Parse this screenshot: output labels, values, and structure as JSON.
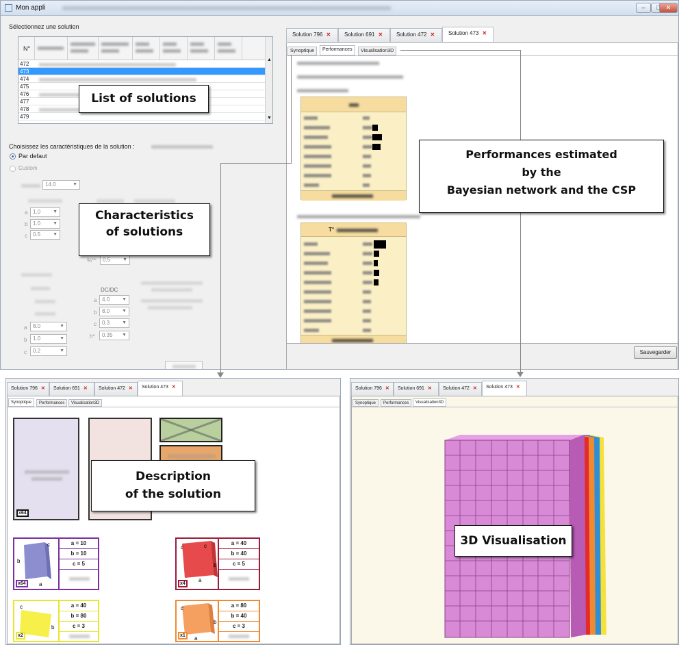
{
  "main_window": {
    "title": "Mon appli",
    "select_label": "Sélectionnez une solution",
    "table_header_first": "N°",
    "rows": [
      "472",
      "473",
      "474",
      "475",
      "476",
      "477",
      "478",
      "479"
    ],
    "characteristics_label": "Choisissez les caractéristiques de la solution :",
    "radio_default": "Par defaut",
    "radio_custom": "Custom",
    "dimension_value": "14.0",
    "combo_a": "1.0",
    "combo_b": "1.0",
    "combo_c": "0.5",
    "combo_pct": "0.5",
    "dcdc_label": "DC/DC",
    "dc_a": "4.0",
    "dc_b": "8.0",
    "dc_c": "0.3",
    "dc_h": "0.35",
    "left_a": "8.0",
    "left_b": "1.0",
    "left_c": "0.2",
    "pct_label": "%**",
    "h_label": "h*",
    "tabs": [
      "Solution 796",
      "Solution 691",
      "Solution 472",
      "Solution 473"
    ],
    "subtabs": [
      "Synoptique",
      "Performances",
      "Visualisation3D"
    ],
    "save_button": "Sauvegarder"
  },
  "callouts": {
    "list": "List of solutions",
    "characteristics_line1": "Characteristics",
    "characteristics_line2": "of solutions",
    "performances_line1": "Performances  estimated",
    "performances_line2": "by the",
    "performances_line3": "Bayesian network and the CSP",
    "description_line1": "Description",
    "description_line2": "of the solution",
    "visualisation": "3D Visualisation"
  },
  "perf_cards": {
    "card2_header_prefix": "T°"
  },
  "synoptique": {
    "big_multiplier": "x64",
    "blocks": [
      {
        "color": "#7b2fa0",
        "a": "a = 10",
        "b": "b = 10",
        "c": "c = 5",
        "mult": "x64"
      },
      {
        "color": "#9b1b3a",
        "a": "a = 40",
        "b": "b = 40",
        "c": "c = 5",
        "mult": "x4"
      },
      {
        "color": "#e9e52a",
        "a": "a = 40",
        "b": "b = 80",
        "c": "c = 3",
        "mult": "x2"
      },
      {
        "color": "#f08a30",
        "a": "a = 80",
        "b": "b = 40",
        "c": "c = 3",
        "mult": "x1"
      }
    ],
    "edge_labels": {
      "a": "a",
      "b": "b",
      "c": "c"
    }
  },
  "colors": {
    "selection": "#3399ff",
    "perf_card": "#fbefc6",
    "visual_bg": "#fbf8ea",
    "cube_pink": "#d88ad6"
  }
}
